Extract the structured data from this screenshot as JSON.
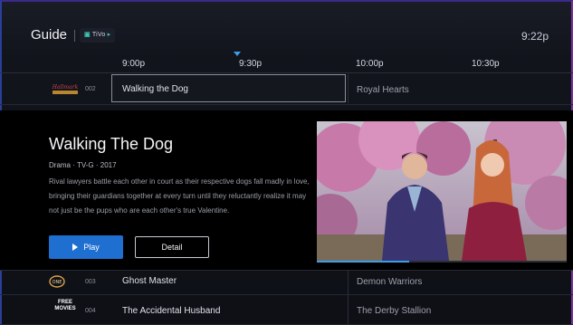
{
  "header": {
    "title": "Guide",
    "provider_badge": "TiVo",
    "clock": "9:22p"
  },
  "timebar": {
    "slots": [
      "9:00p",
      "9:30p",
      "10:00p",
      "10:30p"
    ]
  },
  "rows": [
    {
      "channel_logo": "hallmark-movies-mysteries-logo",
      "channel_number": "002",
      "programs": [
        "Walking the Dog",
        "Royal Hearts"
      ]
    },
    {
      "channel_logo": "one-life-logo",
      "channel_number": "003",
      "programs": [
        "Ghost Master",
        "Demon Warriors"
      ]
    },
    {
      "channel_logo": "free-movies-logo",
      "channel_logo_text": [
        "FREE",
        "MOVIES"
      ],
      "channel_number": "004",
      "programs": [
        "The Accidental Husband",
        "The Derby Stallion"
      ]
    }
  ],
  "detail": {
    "title": "Walking The Dog",
    "meta": "Drama  ·  TV-G  ·  2017",
    "description": "Rival lawyers battle each other in court as their respective dogs fall madly in love, bringing their guardians together at every turn until they reluctantly realize it may not just be the pups who are each other's true Valentine.",
    "play_label": "Play",
    "detail_label": "Detail",
    "progress_fraction": 0.37
  },
  "colors": {
    "accent": "#1f6fd0",
    "progress": "#3a9ee8",
    "background": "#0e1016",
    "detail_panel": "#000000"
  }
}
